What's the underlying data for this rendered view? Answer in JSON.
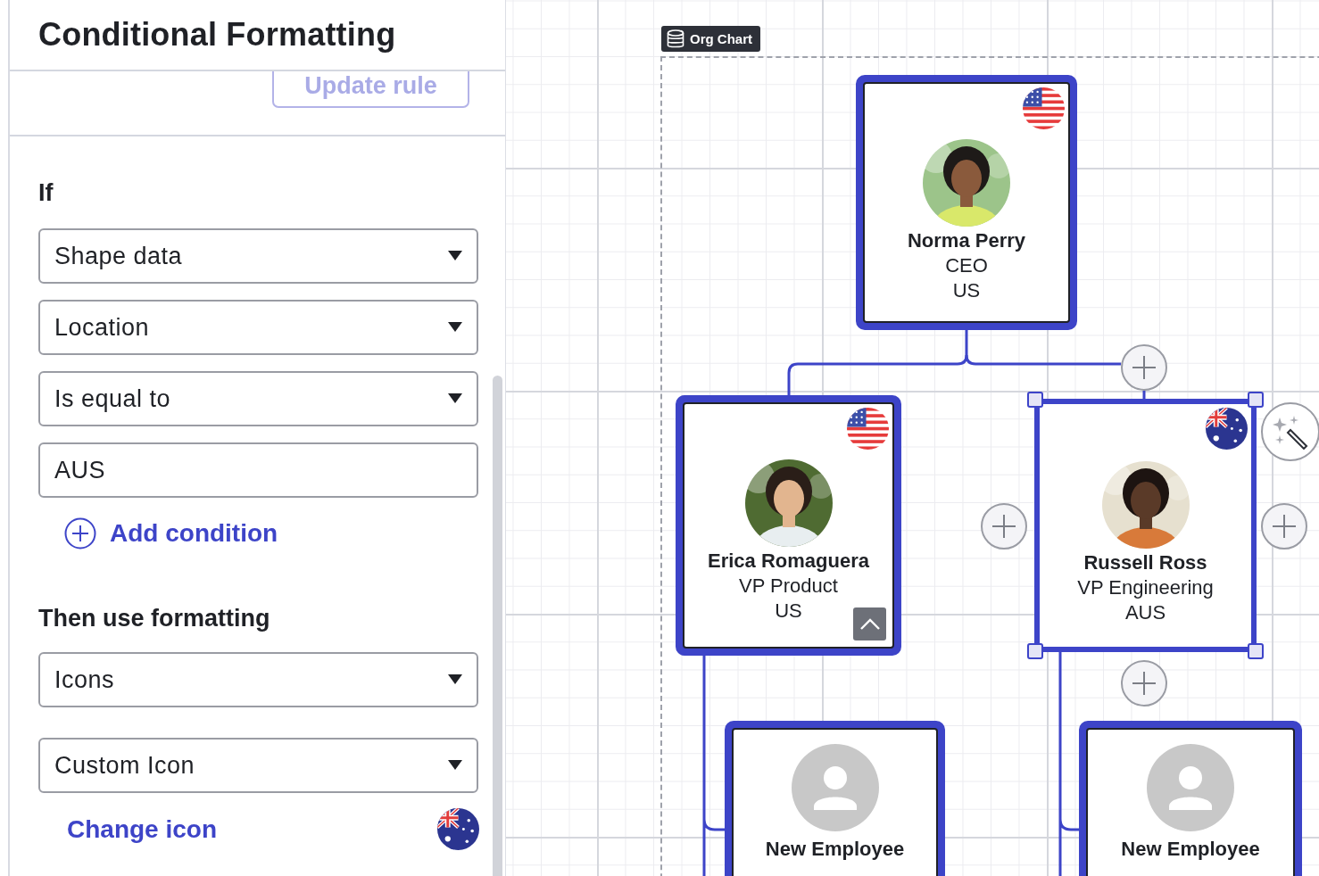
{
  "panel": {
    "title": "Conditional Formatting",
    "update_button": "Update rule",
    "if_label": "If",
    "conditions": [
      {
        "kind": "select",
        "value": "Shape data"
      },
      {
        "kind": "select",
        "value": "Location"
      },
      {
        "kind": "select",
        "value": "Is equal to"
      },
      {
        "kind": "input",
        "value": "AUS"
      }
    ],
    "add_condition": "Add condition",
    "then_label": "Then use formatting",
    "formatting": [
      {
        "kind": "select",
        "value": "Icons"
      },
      {
        "kind": "select",
        "value": "Custom Icon"
      }
    ],
    "change_icon": "Change icon",
    "icon_flag": {
      "kind": "aus"
    }
  },
  "canvas": {
    "container_label": "Org Chart",
    "nodes": [
      {
        "name": "Norma Perry",
        "title": "CEO",
        "location": "US",
        "flag": {
          "kind": "us"
        },
        "selected": false,
        "collapse_button": false
      },
      {
        "name": "Erica Romaguera",
        "title": "VP Product",
        "location": "US",
        "flag": {
          "kind": "us"
        },
        "selected": false,
        "collapse_button": true
      },
      {
        "name": "Russell Ross",
        "title": "VP Engineering",
        "location": "AUS",
        "flag": {
          "kind": "aus"
        },
        "selected": true,
        "collapse_button": false
      },
      {
        "name": "New Employee",
        "photo": {
          "kind": "placeholder"
        },
        "selected": false,
        "collapse_button": false
      },
      {
        "name": "New Employee",
        "photo": {
          "kind": "placeholder"
        },
        "selected": false,
        "collapse_button": false
      }
    ]
  }
}
